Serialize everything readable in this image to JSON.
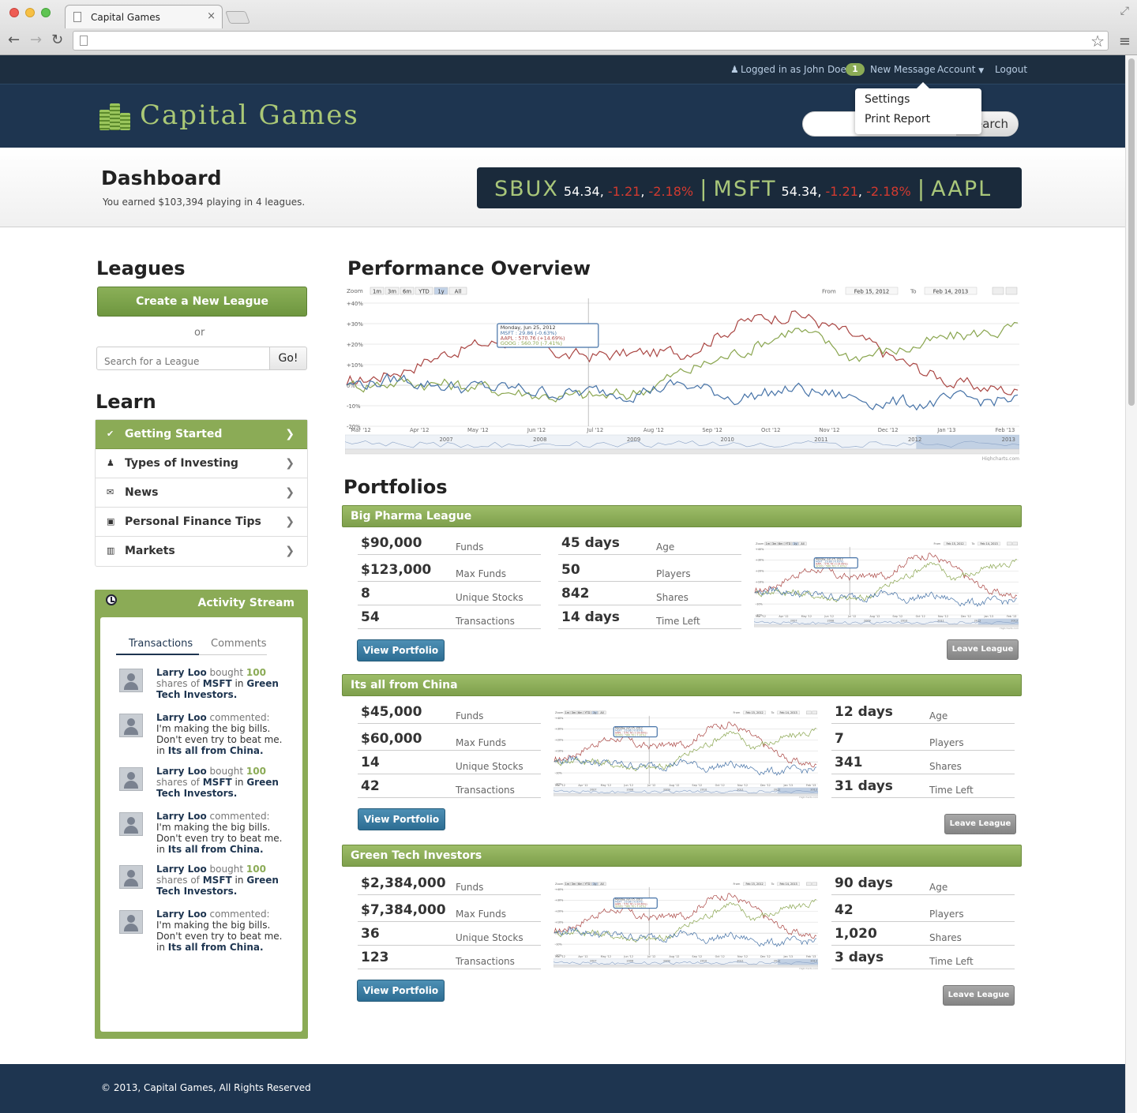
{
  "browser": {
    "tab_title": "Capital Games",
    "tab_close": "×"
  },
  "topbar": {
    "logged_in": "Logged in as John Doe",
    "message_count": "1",
    "new_message": "New Message",
    "account": "Account",
    "logout": "Logout"
  },
  "header": {
    "logo_text": "Capital Games",
    "search_button": "Search",
    "dropdown": [
      "Settings",
      "Print Report"
    ]
  },
  "dashboard": {
    "title": "Dashboard",
    "subtitle": "You earned $103,394 playing in 4 leagues."
  },
  "ticker": [
    {
      "symbol": "SBUX",
      "price": "54.34",
      "change": "-1.21",
      "pct": "-2.18%"
    },
    {
      "symbol": "MSFT",
      "price": "54.34",
      "change": "-1.21",
      "pct": "-2.18%"
    },
    {
      "symbol": "AAPL"
    }
  ],
  "leagues": {
    "title": "Leagues",
    "create_button": "Create a New League",
    "or": "or",
    "search_placeholder": "Search for a League",
    "go_button": "Go!"
  },
  "learn": {
    "title": "Learn",
    "items": [
      {
        "label": "Getting Started",
        "icon": "check-icon"
      },
      {
        "label": "Types of Investing",
        "icon": "user-icon"
      },
      {
        "label": "News",
        "icon": "envelope-icon"
      },
      {
        "label": "Personal Finance Tips",
        "icon": "camera-icon"
      },
      {
        "label": "Markets",
        "icon": "bar-chart-icon"
      }
    ]
  },
  "activity": {
    "title": "Activity Stream",
    "tabs": [
      "Transactions",
      "Comments"
    ],
    "entries": [
      {
        "type": "buy",
        "user": "Larry Loo",
        "verb": "bought",
        "qty": "100",
        "mid1": "shares of",
        "stock": "MSFT",
        "mid2": "in",
        "league": "Green Tech Investors."
      },
      {
        "type": "comment",
        "user": "Larry Loo",
        "verb": "commented:",
        "body": "I'm making the big bills. Don't even try to beat me.",
        "mid2": "in",
        "league": "Its all from China."
      },
      {
        "type": "buy",
        "user": "Larry Loo",
        "verb": "bought",
        "qty": "100",
        "mid1": "shares of",
        "stock": "MSFT",
        "mid2": "in",
        "league": "Green Tech Investors."
      },
      {
        "type": "comment",
        "user": "Larry Loo",
        "verb": "commented:",
        "body": "I'm making the big bills. Don't even try to beat me.",
        "mid2": "in",
        "league": "Its all from China."
      },
      {
        "type": "buy",
        "user": "Larry Loo",
        "verb": "bought",
        "qty": "100",
        "mid1": "shares of",
        "stock": "MSFT",
        "mid2": "in",
        "league": "Green Tech Investors."
      },
      {
        "type": "comment",
        "user": "Larry Loo",
        "verb": "commented:",
        "body": "I'm making the big bills. Don't even try to beat me.",
        "mid2": "in",
        "league": "Its all from China."
      }
    ]
  },
  "performance": {
    "title": "Performance Overview",
    "zoom_label": "Zoom",
    "zoom_buttons": [
      "1m",
      "3m",
      "6m",
      "YTD",
      "1y",
      "All"
    ],
    "from_label": "From",
    "from_date": "Feb 15, 2012",
    "to_label": "To",
    "to_date": "Feb 14, 2013",
    "credit": "Highcharts.com",
    "tooltip": {
      "date": "Monday, Jun 25, 2012",
      "lines": [
        "MSFT : 29.86 (-0.63%)",
        "AAPL : 570.76 (+14.69%)",
        "GOOG : 560.70 (-7.41%)"
      ]
    },
    "colors": {
      "msft": "#4572a7",
      "aapl": "#aa4643",
      "goog": "#89a54e"
    }
  },
  "chart_data": {
    "type": "line",
    "y_tick_labels": [
      "+40%",
      "+30%",
      "+20%",
      "+10%",
      "0%",
      "-10%",
      "-20%"
    ],
    "ylim": [
      -20,
      40
    ],
    "x_tick_labels": [
      "Mar '12",
      "Apr '12",
      "May '12",
      "Jun '12",
      "Jul '12",
      "Aug '12",
      "Sep '12",
      "Oct '12",
      "Nov '12",
      "Dec '12",
      "Jan '13",
      "Feb '13"
    ],
    "navigator_labels": [
      "2007",
      "2008",
      "2009",
      "2010",
      "2011",
      "2012",
      "2013"
    ],
    "x": [
      "Feb '12",
      "Mar '12",
      "Apr '12",
      "May '12",
      "Jun '12",
      "Jul '12",
      "Aug '12",
      "Sep '12",
      "Oct '12",
      "Nov '12",
      "Dec '12",
      "Jan '13",
      "Feb '13"
    ],
    "series": [
      {
        "name": "AAPL",
        "color": "#aa4643",
        "values": [
          0,
          8,
          18,
          22,
          14,
          15,
          16,
          30,
          36,
          24,
          10,
          0,
          -3
        ]
      },
      {
        "name": "GOOG",
        "color": "#89a54e",
        "values": [
          0,
          2,
          0,
          -3,
          -6,
          -5,
          6,
          16,
          28,
          14,
          18,
          24,
          28
        ]
      },
      {
        "name": "MSFT",
        "color": "#4572a7",
        "values": [
          0,
          3,
          -1,
          -2,
          -4,
          -3,
          0,
          -6,
          -2,
          -6,
          -9,
          -8,
          -7
        ]
      }
    ]
  },
  "portfolios": {
    "title": "Portfolios",
    "view_button": "View Portfolio",
    "leave_button": "Leave League",
    "items": [
      {
        "name": "Big Pharma League",
        "funds": "$90,000",
        "max_funds": "$123,000",
        "unique_stocks": "8",
        "transactions": "54",
        "age": "45 days",
        "players": "50",
        "shares": "842",
        "time_left": "14 days"
      },
      {
        "name": "Its all from China",
        "funds": "$45,000",
        "max_funds": "$60,000",
        "unique_stocks": "14",
        "transactions": "42",
        "age": "12 days",
        "players": "7",
        "shares": "341",
        "time_left": "31 days"
      },
      {
        "name": "Green Tech Investors",
        "funds": "$2,384,000",
        "max_funds": "$7,384,000",
        "unique_stocks": "36",
        "transactions": "123",
        "age": "90 days",
        "players": "42",
        "shares": "1,020",
        "time_left": "3 days"
      }
    ],
    "labels": {
      "funds": "Funds",
      "max_funds": "Max Funds",
      "unique_stocks": "Unique Stocks",
      "transactions": "Transactions",
      "age": "Age",
      "players": "Players",
      "shares": "Shares",
      "time_left": "Time Left"
    }
  },
  "footer": {
    "text": "© 2013, Capital Games, All Rights Reserved"
  }
}
